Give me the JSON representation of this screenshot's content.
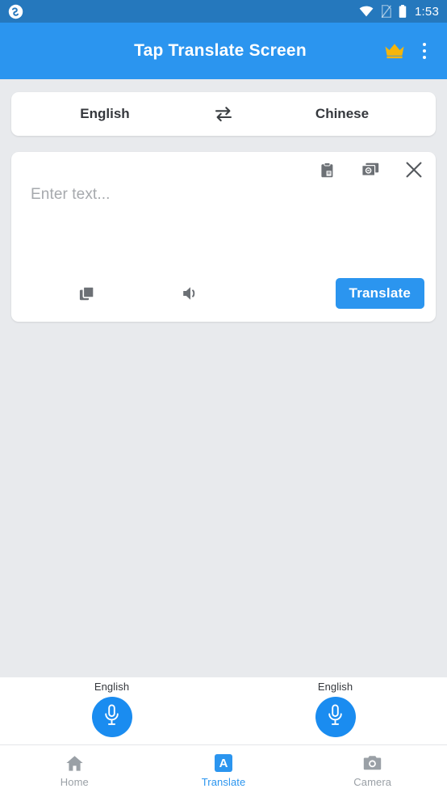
{
  "status_bar": {
    "time": "1:53",
    "icons": [
      "sync-notification-icon",
      "wifi-icon",
      "no-sim-icon",
      "battery-icon"
    ],
    "background": "#2578bd"
  },
  "app_bar": {
    "title": "Tap Translate Screen",
    "background": "#2b95ef",
    "premium_icon": "crown-icon",
    "premium_color": "#f5b50a",
    "overflow_icon": "more-vertical-icon"
  },
  "language_bar": {
    "source_language": "English",
    "target_language": "Chinese",
    "swap_icon": "swap-horizontal-icon"
  },
  "input_card": {
    "placeholder": "Enter text...",
    "value": "",
    "tools": [
      {
        "icon": "paste-clipboard-icon",
        "name": "paste-button"
      },
      {
        "icon": "image-gallery-icon",
        "name": "image-translate-button"
      },
      {
        "icon": "close-icon",
        "name": "clear-button"
      }
    ],
    "copy_icon": "copy-icon",
    "speaker_icon": "speaker-icon",
    "translate_label": "Translate",
    "translate_color": "#2b95ef"
  },
  "mic_panel": {
    "left": {
      "label": "English",
      "icon": "microphone-icon"
    },
    "right": {
      "label": "English",
      "icon": "microphone-icon"
    },
    "mic_color": "#1a8cf0"
  },
  "bottom_nav": {
    "active": "Translate",
    "items": [
      {
        "label": "Home",
        "icon": "home-icon",
        "active": false
      },
      {
        "label": "Translate",
        "icon": "translate-a-icon",
        "active": true
      },
      {
        "label": "Camera",
        "icon": "camera-icon",
        "active": false
      }
    ]
  },
  "theme": {
    "page_background": "#e8eaed",
    "accent": "#2b95ef",
    "inactive": "#9aa0a6"
  }
}
